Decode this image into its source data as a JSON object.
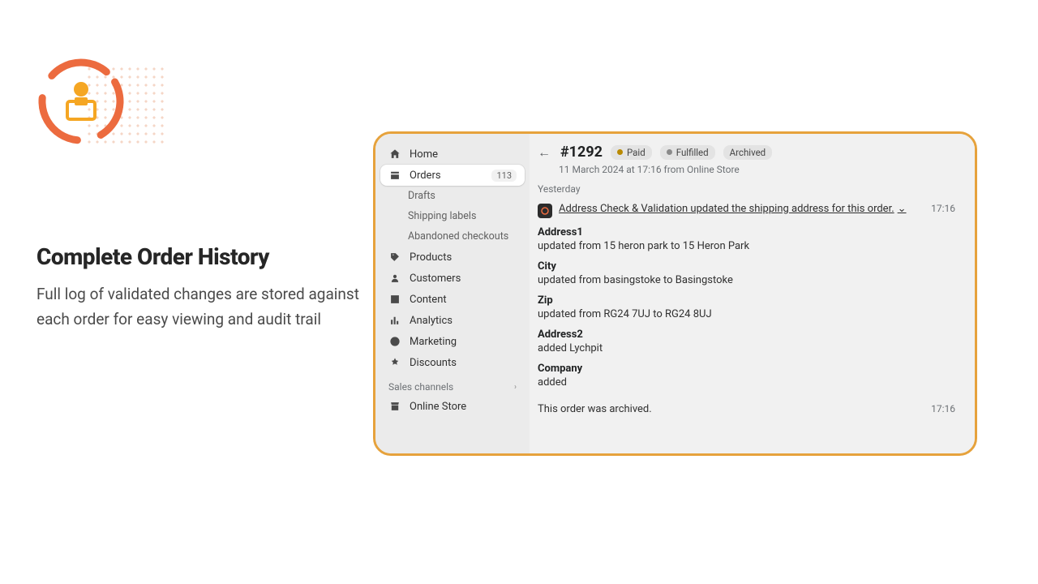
{
  "marketing": {
    "heading": "Complete Order History",
    "sub": "Full log of validated changes are stored against each order for easy viewing and audit trail"
  },
  "sidebar": {
    "items": [
      {
        "label": "Home"
      },
      {
        "label": "Orders",
        "badge": "113"
      },
      {
        "label": "Products"
      },
      {
        "label": "Customers"
      },
      {
        "label": "Content"
      },
      {
        "label": "Analytics"
      },
      {
        "label": "Marketing"
      },
      {
        "label": "Discounts"
      }
    ],
    "orders_sub": [
      {
        "label": "Drafts"
      },
      {
        "label": "Shipping labels"
      },
      {
        "label": "Abandoned checkouts"
      }
    ],
    "section": "Sales channels",
    "channel": "Online Store"
  },
  "order": {
    "id": "#1292",
    "pills": [
      {
        "label": "Paid",
        "dot": "warn"
      },
      {
        "label": "Fulfilled",
        "dot": "grey"
      },
      {
        "label": "Archived",
        "dot": null
      }
    ],
    "meta": "11 March 2024 at 17:16 from Online Store",
    "day": "Yesterday",
    "event_title": "Address Check & Validation updated the shipping address for this order.",
    "event_time": "17:16",
    "changes": [
      {
        "label": "Address1",
        "desc": "updated from 15 heron park to 15 Heron Park"
      },
      {
        "label": "City",
        "desc": "updated from basingstoke to Basingstoke"
      },
      {
        "label": "Zip",
        "desc": "updated from RG24 7UJ to RG24 8UJ"
      },
      {
        "label": "Address2",
        "desc": "added Lychpit"
      },
      {
        "label": "Company",
        "desc": "added"
      }
    ],
    "archived_text": "This order was archived.",
    "archived_time": "17:16"
  }
}
